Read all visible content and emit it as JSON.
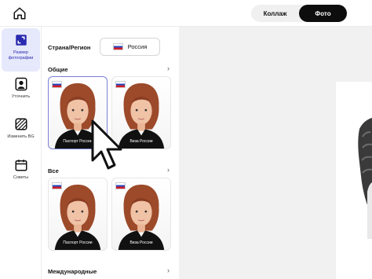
{
  "topbar": {
    "home_icon": "home-icon",
    "modes": [
      "Коллаж",
      "Фото"
    ],
    "active_mode": "Фото"
  },
  "sidebar": {
    "items": [
      {
        "label": "Размер фотографии",
        "icon": "crop-icon",
        "active": true
      },
      {
        "label": "Уточнить",
        "icon": "portrait-icon",
        "active": false
      },
      {
        "label": "Изменить BG",
        "icon": "stripes-icon",
        "active": false
      },
      {
        "label": "Советы",
        "icon": "calendar-icon",
        "active": false
      }
    ]
  },
  "panel": {
    "region_label": "Страна/Регион",
    "region_value": "Россия",
    "sections": [
      {
        "title": "Общие",
        "cards": [
          "Паспорт России",
          "Виза России"
        ]
      },
      {
        "title": "Все",
        "cards": [
          "Паспорт России",
          "Виза России"
        ]
      },
      {
        "title": "Международные",
        "cards": []
      }
    ],
    "section_arrow": "›"
  },
  "colors": {
    "accent": "#2a2ab0",
    "active_bg": "#e6e8fb",
    "selected_border": "#7b7fd6",
    "hair": "#9c4a2a",
    "shirt": "#111111",
    "dark_button": "#0d0d0d"
  }
}
